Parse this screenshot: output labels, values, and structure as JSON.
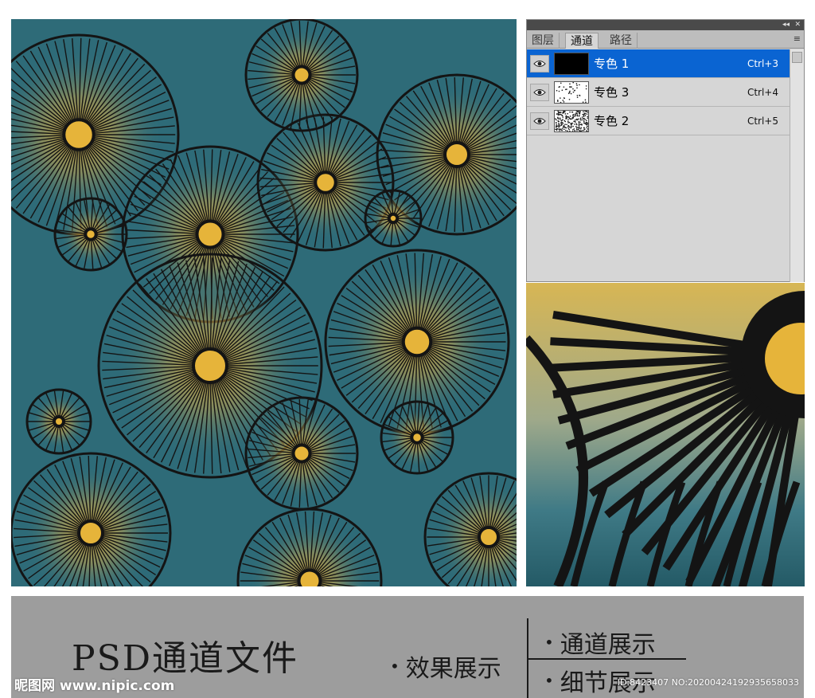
{
  "panel": {
    "tabs": [
      {
        "label": "图层",
        "active": false
      },
      {
        "label": "通道",
        "active": true
      },
      {
        "label": "路径",
        "active": false
      }
    ],
    "titlebar_buttons": [
      "◂◂",
      "✕"
    ],
    "menu_icon": "≡"
  },
  "channels": [
    {
      "name": "专色 1",
      "shortcut": "Ctrl+3",
      "selected": true,
      "thumb": "black"
    },
    {
      "name": "专色 3",
      "shortcut": "Ctrl+4",
      "selected": false,
      "thumb": "sparse-dots"
    },
    {
      "name": "专色 2",
      "shortcut": "Ctrl+5",
      "selected": false,
      "thumb": "dense-dots"
    }
  ],
  "caption": {
    "title": "PSD通道文件",
    "bullet": "•",
    "item_effect": "效果展示",
    "item_channel": "通道展示",
    "item_detail": "细节展示"
  },
  "watermark": {
    "left": "昵图网 www.nipic.com",
    "right": "ID:8423407 NO:20200424192935658033"
  },
  "colors": {
    "teal": "#2e6b78",
    "gold": "#e6b43a",
    "ink": "#141414",
    "selection": "#0a64d2",
    "caption_bg": "#9d9d9d"
  },
  "icons": {
    "eye": "eye-icon",
    "panel_menu": "panel-menu-icon",
    "collapse": "collapse-icon",
    "close": "close-icon"
  }
}
